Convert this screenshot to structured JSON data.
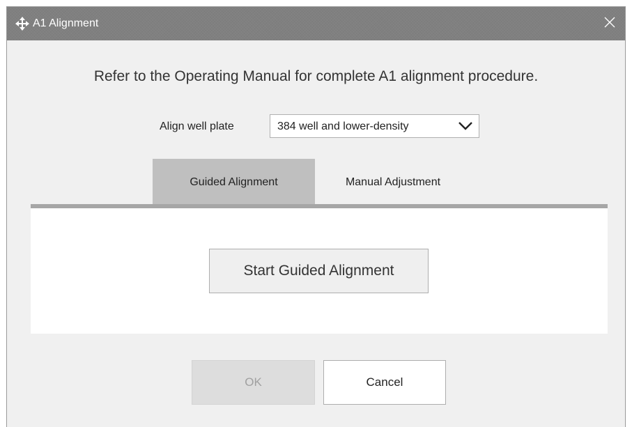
{
  "window": {
    "title": "A1 Alignment",
    "title_icon": "move-icon",
    "close_icon": "close-icon"
  },
  "instruction": "Refer to the Operating Manual for complete A1 alignment procedure.",
  "plate": {
    "label": "Align well plate",
    "selected": "384 well and lower-density",
    "dropdown_icon": "chevron-down-icon"
  },
  "tabs": [
    {
      "label": "Guided Alignment",
      "active": true
    },
    {
      "label": "Manual Adjustment",
      "active": false
    }
  ],
  "panel": {
    "start_button": "Start Guided Alignment"
  },
  "footer": {
    "ok_label": "OK",
    "ok_enabled": false,
    "cancel_label": "Cancel"
  },
  "colors": {
    "titlebar": "#808080",
    "dialog_bg": "#f0f0f0",
    "active_tab": "#bfbfbf",
    "tab_underline": "#a6a6a6",
    "disabled_button": "#dddddd"
  }
}
